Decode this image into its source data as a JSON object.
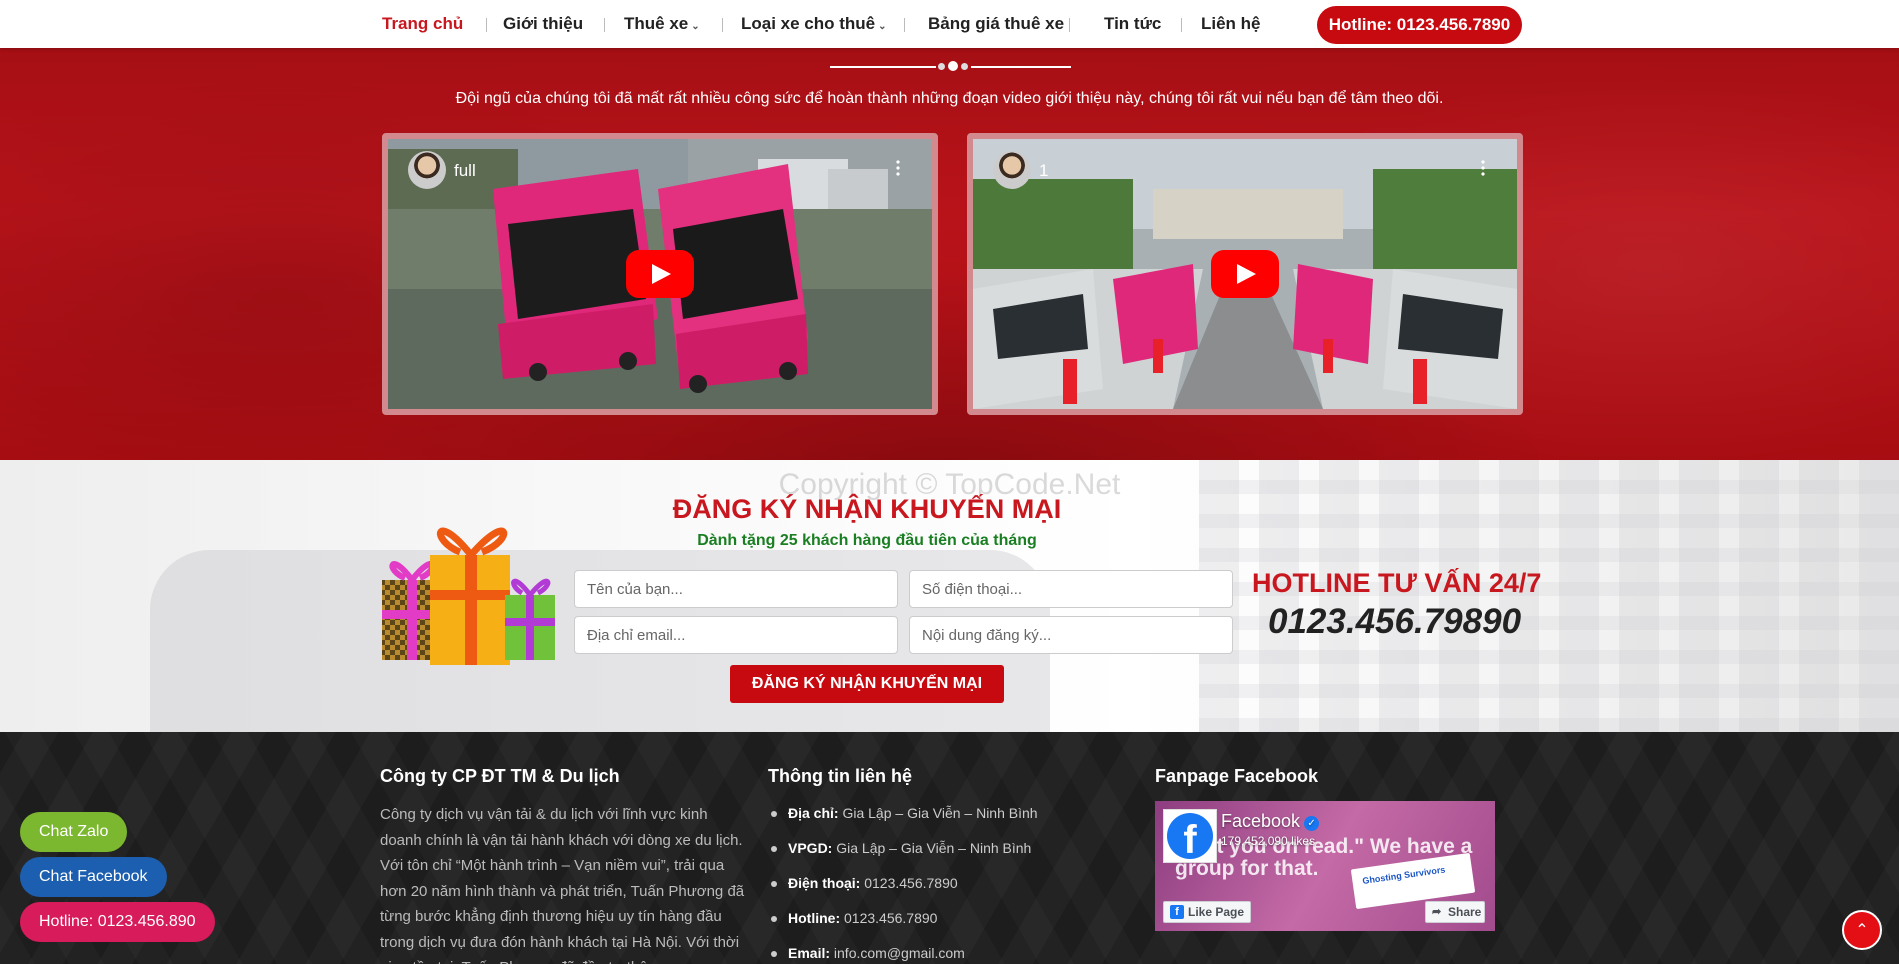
{
  "nav": {
    "items": [
      {
        "label": "Trang chủ",
        "active": true,
        "dropdown": false
      },
      {
        "label": "Giới thiệu",
        "active": false,
        "dropdown": false
      },
      {
        "label": "Thuê xe",
        "active": false,
        "dropdown": true
      },
      {
        "label": "Loại xe cho thuê",
        "active": false,
        "dropdown": true
      },
      {
        "label": "Bảng giá thuê xe",
        "active": false,
        "dropdown": false
      },
      {
        "label": "Tin tức",
        "active": false,
        "dropdown": false
      },
      {
        "label": "Liên hệ",
        "active": false,
        "dropdown": false
      }
    ],
    "hotline": "Hotline: 0123.456.7890"
  },
  "video_section": {
    "subtitle": "Đội ngũ của chúng tôi đã mất rất nhiều công sức để hoàn thành những đoạn video giới thiệu này, chúng tôi rất vui nếu bạn để tâm theo dõi.",
    "videos": [
      {
        "title": "full"
      },
      {
        "title": "1"
      }
    ]
  },
  "promo": {
    "watermark": "Copyright © TopCode.Net",
    "title": "ĐĂNG KÝ NHẬN KHUYẾN MẠI",
    "subtitle": "Dành tặng 25 khách hàng đầu tiên của tháng",
    "fields": {
      "name": "Tên của bạn...",
      "phone": "Số điện thoại...",
      "email": "Địa chỉ email...",
      "content": "Nội dung đăng ký..."
    },
    "submit": "ĐĂNG KÝ NHẬN KHUYẾN MẠI",
    "hotline_title": "HOTLINE TƯ VẤN 24/7",
    "hotline_number": "0123.456.79890"
  },
  "footer": {
    "company": {
      "heading": "Công ty CP ĐT TM & Du lịch",
      "text": "Công ty dịch vụ vận tải & du lịch với lĩnh vực kinh doanh chính là vận tải hành khách với dòng xe du lịch. Với tôn chỉ “Một hành trình – Vạn niềm vui”, trải qua hơn 20 năm hình thành và phát triển, Tuấn Phương đã từng bước khẳng định thương hiệu uy tín hàng đầu trong dịch vụ đưa đón hành khách tại Hà Nội. Với thời gian tồn tại, Tuấn Phương đã đầu tư thêm"
    },
    "contact": {
      "heading": "Thông tin liên hệ",
      "items": [
        {
          "label": "Địa chỉ:",
          "value": "Gia Lập – Gia Viễn – Ninh Bình"
        },
        {
          "label": "VPGD:",
          "value": "Gia Lập – Gia Viễn – Ninh Bình"
        },
        {
          "label": "Điện thoại:",
          "value": "0123.456.7890"
        },
        {
          "label": "Hotline:",
          "value": "0123.456.7890"
        },
        {
          "label": "Email:",
          "value": "info.com@gmail.com"
        }
      ]
    },
    "fanpage": {
      "heading": "Fanpage Facebook",
      "page_name": "Facebook",
      "likes": "179,452,090 likes",
      "cover_text": "\"Left you on read.\" We have a group for that.",
      "card_text": "Ghosting Survivors",
      "like_label": "Like Page",
      "share_label": "Share"
    }
  },
  "floating": {
    "zalo": "Chat Zalo",
    "facebook": "Chat Facebook",
    "hotline": "Hotline: 0123.456.890",
    "colors": {
      "zalo": "#7cb82f",
      "facebook": "#1c5fb0",
      "hotline": "#d81b5a"
    }
  }
}
